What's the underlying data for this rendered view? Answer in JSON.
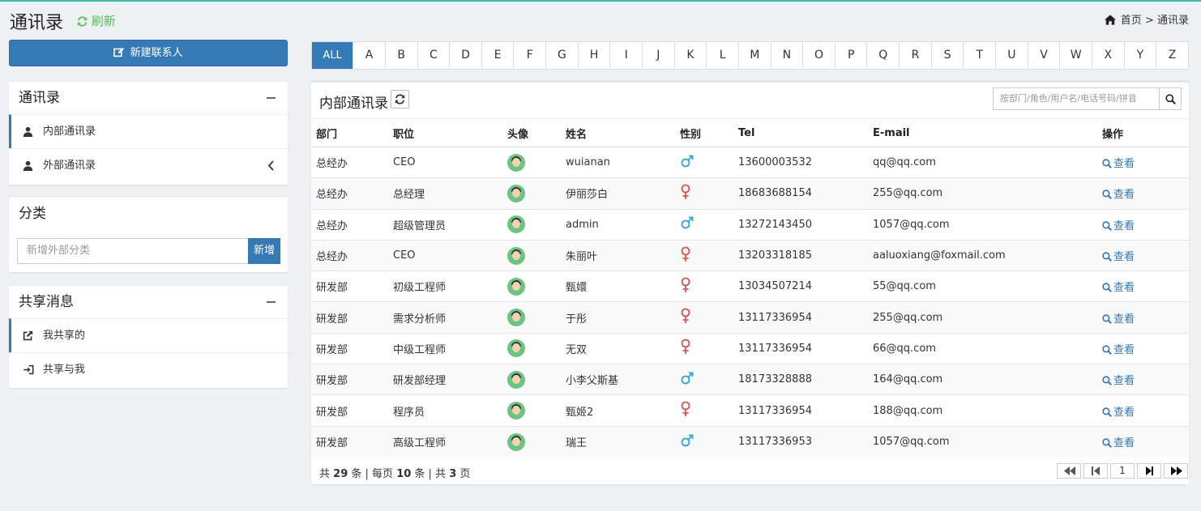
{
  "header": {
    "title": "通讯录",
    "refresh_label": "刷新",
    "breadcrumb_home": "首页",
    "breadcrumb_sep": ">",
    "breadcrumb_current": "通讯录"
  },
  "left": {
    "new_contact_label": "新建联系人",
    "contacts_panel": {
      "title": "通讯录",
      "items": [
        {
          "label": "内部通讯录"
        },
        {
          "label": "外部通讯录"
        }
      ]
    },
    "category_panel": {
      "title": "分类",
      "input_placeholder": "新增外部分类",
      "add_label": "新增"
    },
    "share_panel": {
      "title": "共享消息",
      "items": [
        {
          "label": "我共享的"
        },
        {
          "label": "共享与我"
        }
      ]
    }
  },
  "alphabet": [
    "ALL",
    "A",
    "B",
    "C",
    "D",
    "E",
    "F",
    "G",
    "H",
    "I",
    "J",
    "K",
    "L",
    "M",
    "N",
    "O",
    "P",
    "Q",
    "R",
    "S",
    "T",
    "U",
    "V",
    "W",
    "X",
    "Y",
    "Z"
  ],
  "main": {
    "title": "内部通讯录",
    "search_placeholder": "按部门/角色/用户名/电话号码/拼音",
    "columns": [
      "部门",
      "职位",
      "头像",
      "姓名",
      "性别",
      "Tel",
      "E-mail",
      "操作"
    ],
    "rows": [
      {
        "dept": "总经办",
        "position": "CEO",
        "name": "wuianan",
        "gender": "male",
        "tel": "13600003532",
        "email": "qq@qq.com",
        "action": "查看"
      },
      {
        "dept": "总经办",
        "position": "总经理",
        "name": "伊丽莎白",
        "gender": "female",
        "tel": "18683688154",
        "email": "255@qq.com",
        "action": "查看"
      },
      {
        "dept": "总经办",
        "position": "超级管理员",
        "name": "admin",
        "gender": "male",
        "tel": "13272143450",
        "email": "1057@qq.com",
        "action": "查看"
      },
      {
        "dept": "总经办",
        "position": "CEO",
        "name": "朱丽叶",
        "gender": "female",
        "tel": "13203318185",
        "email": "aaluoxiang@foxmail.com",
        "action": "查看"
      },
      {
        "dept": "研发部",
        "position": "初级工程师",
        "name": "甄嬛",
        "gender": "female",
        "tel": "13034507214",
        "email": "55@qq.com",
        "action": "查看"
      },
      {
        "dept": "研发部",
        "position": "需求分析师",
        "name": "于彤",
        "gender": "female",
        "tel": "13117336954",
        "email": "255@qq.com",
        "action": "查看"
      },
      {
        "dept": "研发部",
        "position": "中级工程师",
        "name": "无双",
        "gender": "female",
        "tel": "13117336954",
        "email": "66@qq.com",
        "action": "查看"
      },
      {
        "dept": "研发部",
        "position": "研发部经理",
        "name": "小李父斯基",
        "gender": "male",
        "tel": "18173328888",
        "email": "164@qq.com",
        "action": "查看"
      },
      {
        "dept": "研发部",
        "position": "程序员",
        "name": "甄姬2",
        "gender": "female",
        "tel": "13117336954",
        "email": "188@qq.com",
        "action": "查看"
      },
      {
        "dept": "研发部",
        "position": "高级工程师",
        "name": "瑞王",
        "gender": "male",
        "tel": "13117336953",
        "email": "1057@qq.com",
        "action": "查看"
      }
    ],
    "footer": {
      "total_prefix": "共",
      "total": "29",
      "total_unit": "条 | 每页",
      "per_page": "10",
      "per_page_unit": "条 | 共",
      "pages": "3",
      "pages_unit": "页"
    },
    "current_page": "1"
  },
  "colors": {
    "primary": "#337ab7",
    "refresh": "#5cb85c",
    "male": "#2fa4d8",
    "female": "#d9534f",
    "avatar_bg": "#6dc382"
  }
}
